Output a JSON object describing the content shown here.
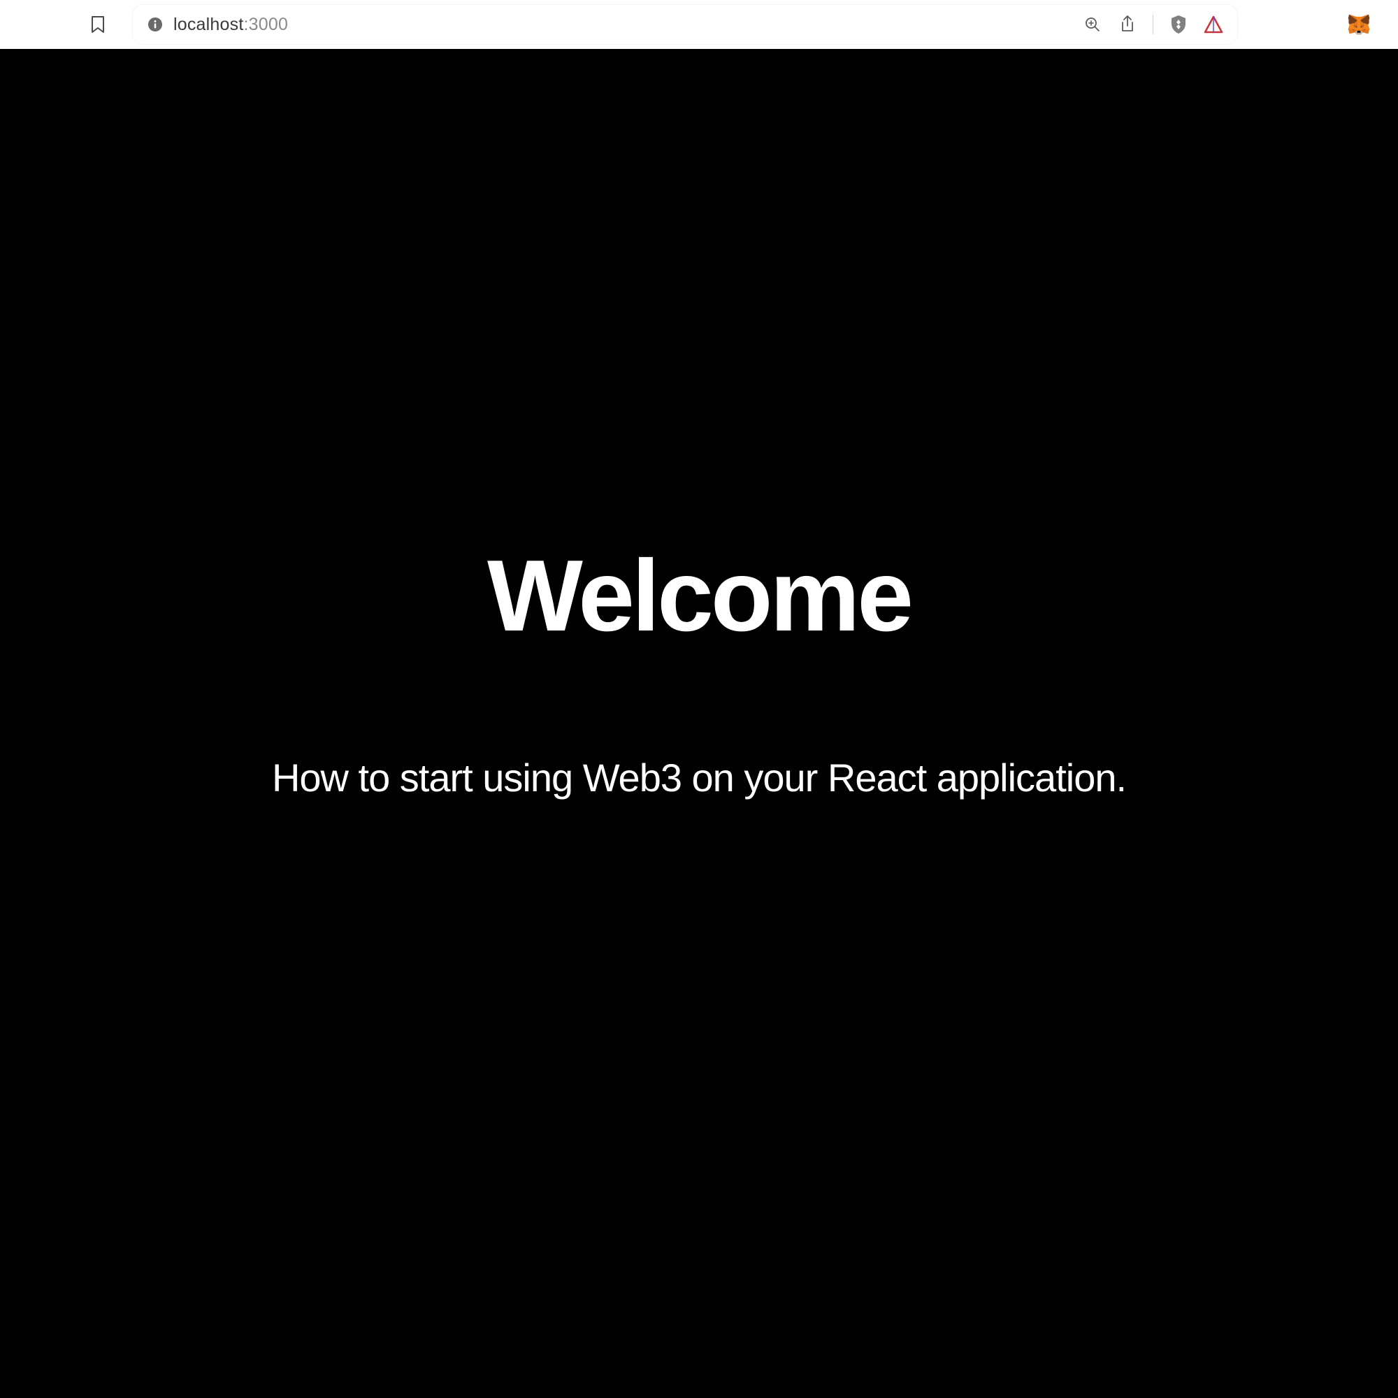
{
  "browser": {
    "url_host": "localhost",
    "url_port": ":3000",
    "icons": {
      "bookmark": "bookmark-icon",
      "info": "info-icon",
      "zoom": "zoom-icon",
      "share": "share-icon",
      "brave_shield": "brave-shield-icon",
      "brave_logo": "brave-logo-icon",
      "metamask": "metamask-icon"
    }
  },
  "page": {
    "title": "Welcome",
    "subtitle": "How to start using Web3 on your React application."
  },
  "colors": {
    "page_bg": "#000000",
    "page_text": "#ffffff",
    "chrome_bg": "#ffffff",
    "url_primary": "#3a3a3a",
    "url_secondary": "#8a8a8a"
  }
}
